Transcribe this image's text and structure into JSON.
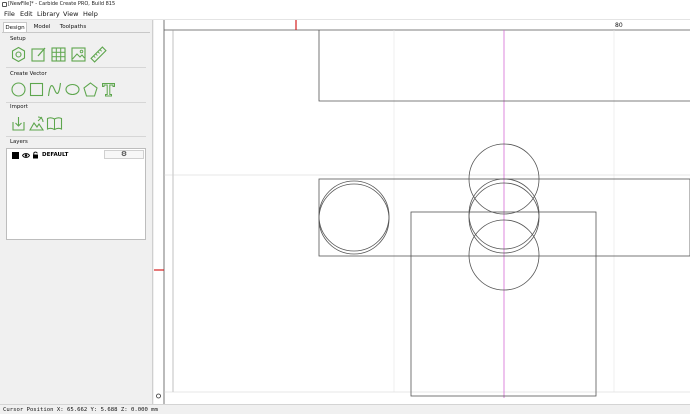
{
  "window": {
    "title": "[NewFile]* - Carbide Create PRO, Build 815"
  },
  "menu": {
    "items": [
      "File",
      "Edit",
      "Library",
      "View",
      "Help"
    ]
  },
  "tabs": [
    "Design",
    "Model",
    "Toolpaths"
  ],
  "sections": {
    "setup": "Setup",
    "create_vector": "Create Vector",
    "import": "Import",
    "layers": "Layers"
  },
  "layers": [
    {
      "name": "DEFAULT",
      "color": "#000000"
    }
  ],
  "ruler": {
    "top_label": "80"
  },
  "status": {
    "cursor_position": "Cursor Position X: 65.662 Y: 5.688 Z: 0.000 mm"
  },
  "colors": {
    "icon_green": "#5ea64e",
    "guide_magenta": "#d46ad4",
    "ruler_marker": "#d42020",
    "tab_active_bg": "#ffffff"
  },
  "icons": {
    "setup": [
      "job-setup-icon",
      "edit-stock-icon",
      "grid-icon",
      "image-icon",
      "measure-icon"
    ],
    "create_vector": [
      "circle-icon",
      "rectangle-icon",
      "curve-icon",
      "ellipse-icon",
      "polygon-icon",
      "text-icon"
    ],
    "import": [
      "import-svg-icon",
      "import-trace-icon",
      "import-book-icon"
    ]
  }
}
